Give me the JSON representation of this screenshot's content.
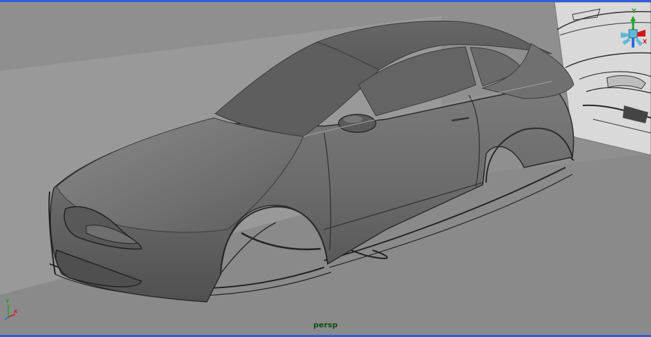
{
  "viewport": {
    "camera_label": "persp",
    "border_color": "#2e5fd8",
    "background_color": "#8c8c8c"
  },
  "scene": {
    "object": "car-body-model",
    "reference_image": "car-blueprint-reference"
  },
  "view_cube": {
    "icon": "view-cube-icon",
    "axis_labels": {
      "y": "Y",
      "x": "X"
    },
    "colors": {
      "y": "#1ea81e",
      "x": "#d01818",
      "z": "#2a6ad8",
      "center": "#5fb8d8"
    }
  },
  "axis_indicator": {
    "icon": "world-axis-icon",
    "labels": {
      "y": "y",
      "x": "x"
    },
    "colors": {
      "y": "#1ea81e",
      "x": "#d01818",
      "z": "#2a6ad8"
    }
  }
}
